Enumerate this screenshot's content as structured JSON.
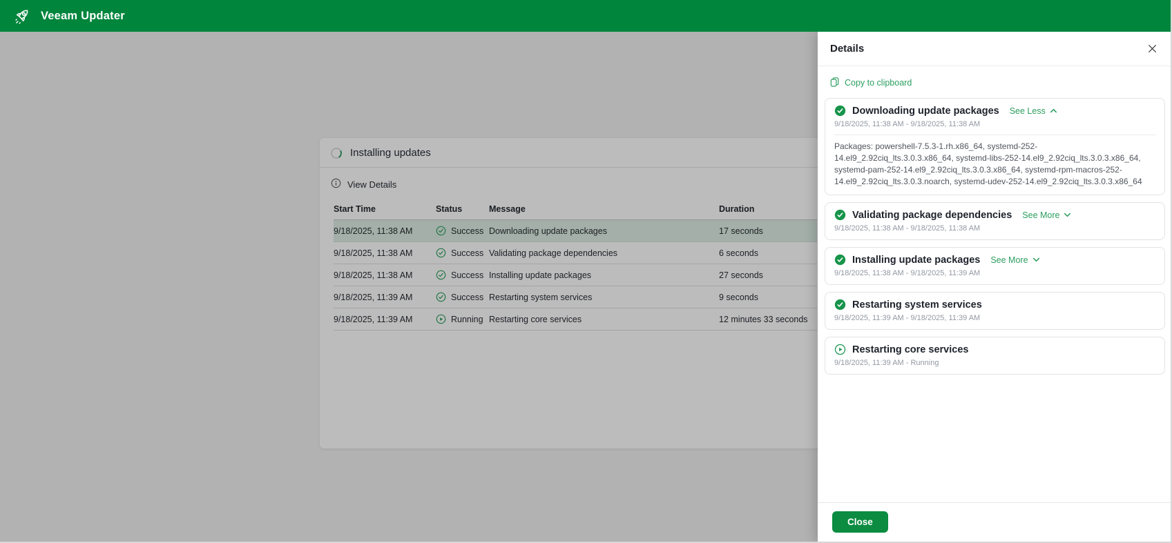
{
  "app": {
    "title": "Veeam Updater"
  },
  "main": {
    "title": "Installing updates",
    "view_details_label": "View Details",
    "table": {
      "columns": [
        "Start Time",
        "Status",
        "Message",
        "Duration"
      ],
      "rows": [
        {
          "start_time": "9/18/2025, 11:38 AM",
          "status": "Success",
          "message": "Downloading update packages",
          "duration": "17 seconds",
          "highlighted": true
        },
        {
          "start_time": "9/18/2025, 11:38 AM",
          "status": "Success",
          "message": "Validating package dependencies",
          "duration": "6 seconds",
          "highlighted": false
        },
        {
          "start_time": "9/18/2025, 11:38 AM",
          "status": "Success",
          "message": "Installing update packages",
          "duration": "27 seconds",
          "highlighted": false
        },
        {
          "start_time": "9/18/2025, 11:39 AM",
          "status": "Success",
          "message": "Restarting system services",
          "duration": "9 seconds",
          "highlighted": false
        },
        {
          "start_time": "9/18/2025, 11:39 AM",
          "status": "Running",
          "message": "Restarting core services",
          "duration": "12 minutes 33 seconds",
          "highlighted": false
        }
      ]
    }
  },
  "details_panel": {
    "title": "Details",
    "copy_label": "Copy to clipboard",
    "close_button": "Close",
    "items": [
      {
        "status": "success",
        "title": "Downloading update packages",
        "toggle": "See Less",
        "chevron": "up",
        "time_range": "9/18/2025, 11:38 AM - 9/18/2025, 11:38 AM",
        "body": "Packages: powershell-7.5.3-1.rh.x86_64, systemd-252-14.el9_2.92ciq_lts.3.0.3.x86_64, systemd-libs-252-14.el9_2.92ciq_lts.3.0.3.x86_64, systemd-pam-252-14.el9_2.92ciq_lts.3.0.3.x86_64, systemd-rpm-macros-252-14.el9_2.92ciq_lts.3.0.3.noarch, systemd-udev-252-14.el9_2.92ciq_lts.3.0.3.x86_64"
      },
      {
        "status": "success",
        "title": "Validating package dependencies",
        "toggle": "See More",
        "chevron": "down",
        "time_range": "9/18/2025, 11:38 AM - 9/18/2025, 11:38 AM"
      },
      {
        "status": "success",
        "title": "Installing update packages",
        "toggle": "See More",
        "chevron": "down",
        "time_range": "9/18/2025, 11:38 AM - 9/18/2025, 11:39 AM"
      },
      {
        "status": "success",
        "title": "Restarting system services",
        "time_range": "9/18/2025, 11:39 AM - 9/18/2025, 11:39 AM"
      },
      {
        "status": "running",
        "title": "Restarting core services",
        "time_range": "9/18/2025, 11:39 AM - Running"
      }
    ]
  },
  "colors": {
    "brand_green": "#00853c",
    "link_green": "#2b9e5e",
    "success_green": "#17944a",
    "highlight_row": "#ddeee3"
  }
}
